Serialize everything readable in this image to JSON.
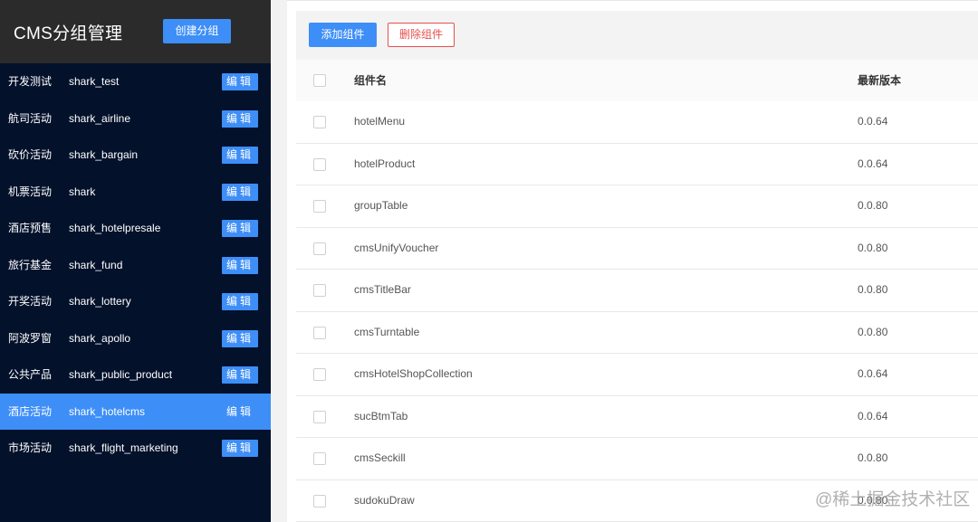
{
  "sidebar": {
    "title": "CMS分组管理",
    "create_label": "创建分组",
    "edit_label": "编辑",
    "groups": [
      {
        "name": "开发测试",
        "key": "shark_test"
      },
      {
        "name": "航司活动",
        "key": "shark_airline"
      },
      {
        "name": "砍价活动",
        "key": "shark_bargain"
      },
      {
        "name": "机票活动",
        "key": "shark"
      },
      {
        "name": "酒店预售",
        "key": "shark_hotelpresale"
      },
      {
        "name": "旅行基金",
        "key": "shark_fund"
      },
      {
        "name": "开奖活动",
        "key": "shark_lottery"
      },
      {
        "name": "阿波罗窗",
        "key": "shark_apollo"
      },
      {
        "name": "公共产品",
        "key": "shark_public_product"
      },
      {
        "name": "酒店活动",
        "key": "shark_hotelcms",
        "active": true
      },
      {
        "name": "市场活动",
        "key": "shark_flight_marketing"
      }
    ]
  },
  "toolbar": {
    "add_label": "添加组件",
    "delete_label": "删除组件"
  },
  "table": {
    "columns": [
      "组件名",
      "最新版本"
    ],
    "rows": [
      {
        "name": "hotelMenu",
        "version": "0.0.64"
      },
      {
        "name": "hotelProduct",
        "version": "0.0.64"
      },
      {
        "name": "groupTable",
        "version": "0.0.80"
      },
      {
        "name": "cmsUnifyVoucher",
        "version": "0.0.80"
      },
      {
        "name": "cmsTitleBar",
        "version": "0.0.80"
      },
      {
        "name": "cmsTurntable",
        "version": "0.0.80"
      },
      {
        "name": "cmsHotelShopCollection",
        "version": "0.0.64"
      },
      {
        "name": "sucBtmTab",
        "version": "0.0.64"
      },
      {
        "name": "cmsSeckill",
        "version": "0.0.80"
      },
      {
        "name": "sudokuDraw",
        "version": "0.0.80"
      }
    ]
  },
  "watermark": "@稀土掘金技术社区",
  "colors": {
    "primary": "#3e8ef7",
    "sidebar_bg": "#03112b",
    "header_bg": "#2b2b2b",
    "danger": "#e65050"
  }
}
